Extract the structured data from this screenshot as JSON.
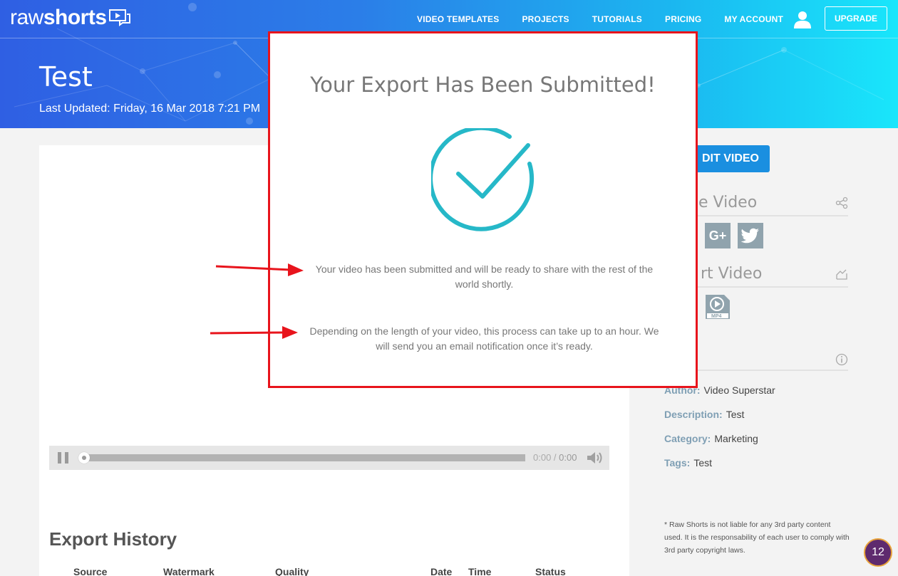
{
  "header": {
    "logo_raw": "raw",
    "logo_shorts": "shorts",
    "nav": [
      "VIDEO TEMPLATES",
      "PROJECTS",
      "TUTORIALS",
      "PRICING",
      "MY ACCOUNT"
    ],
    "upgrade_label": "UPGRADE",
    "page_title": "Test",
    "last_updated": "Last Updated: Friday, 16 Mar 2018 7:21 PM"
  },
  "player": {
    "current_time": "0:00",
    "separator": " / ",
    "duration": "0:00",
    "progress": 0
  },
  "export_history": {
    "title": "Export History",
    "columns": [
      "Source",
      "Watermark",
      "Quality",
      "Date",
      "Time",
      "Status"
    ]
  },
  "sidebar": {
    "edit_label": "DIT VIDEO",
    "share_heading": "e Video",
    "export_heading": "rt Video",
    "social": [
      "G+",
      "twitter-icon"
    ],
    "mp4_label": "MP4",
    "meta": [
      {
        "key": "Author:",
        "value": "Video Superstar"
      },
      {
        "key": "Description:",
        "value": "Test"
      },
      {
        "key": "Category:",
        "value": "Marketing"
      },
      {
        "key": "Tags:",
        "value": "Test"
      }
    ],
    "disclaimer": "* Raw Shorts is not liable for any 3rd party content used. It is the responsability of each user to comply with 3rd party copyright laws."
  },
  "modal": {
    "title": "Your Export Has Been Submitted!",
    "message_1": "Your video has been submitted and will be ready to share with the rest of the world shortly.",
    "message_2": "Depending on the length of your video, this process can take up to an hour. We will send you an email notification once it’s ready.",
    "border_color": "#e8141c",
    "check_color": "#26b8c8"
  },
  "badge": {
    "count": "12"
  },
  "colors": {
    "accent": "#1a8fe0",
    "annotation": "#e8141c"
  }
}
